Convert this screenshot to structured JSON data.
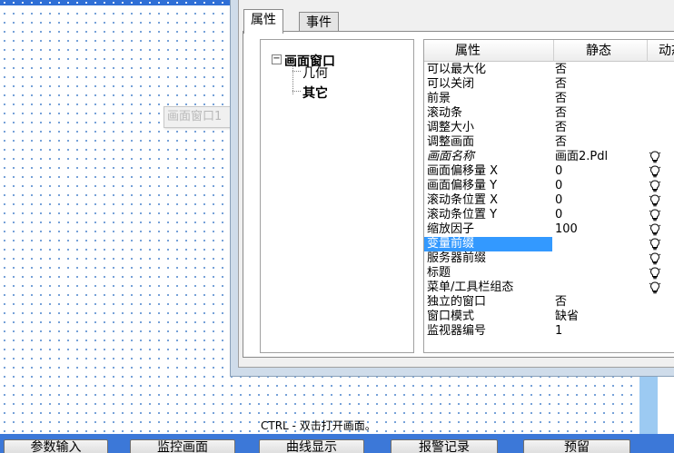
{
  "background_label": "画面窗口1",
  "hint_text": "CTRL - 双击打开画面。",
  "bottom_buttons": [
    "参数输入",
    "监控画面",
    "曲线显示",
    "报警记录",
    "预留"
  ],
  "dialog": {
    "tabs": [
      {
        "label": "属性",
        "active": true
      },
      {
        "label": "事件",
        "active": false
      }
    ],
    "tree": {
      "root": "画面窗口",
      "root_toggle": "−",
      "children": [
        "几何",
        "其它"
      ],
      "selected": "其它"
    },
    "grid": {
      "headers": [
        "属性",
        "静态",
        "动态"
      ],
      "rows": [
        {
          "name": "可以最大化",
          "static": "否",
          "dynamic": false,
          "italic": false,
          "selected": false
        },
        {
          "name": "可以关闭",
          "static": "否",
          "dynamic": false,
          "italic": false,
          "selected": false
        },
        {
          "name": "前景",
          "static": "否",
          "dynamic": false,
          "italic": false,
          "selected": false
        },
        {
          "name": "滚动条",
          "static": "否",
          "dynamic": false,
          "italic": false,
          "selected": false
        },
        {
          "name": "调整大小",
          "static": "否",
          "dynamic": false,
          "italic": false,
          "selected": false
        },
        {
          "name": "调整画面",
          "static": "否",
          "dynamic": false,
          "italic": false,
          "selected": false
        },
        {
          "name": "画面名称",
          "static": "画面2.Pdl",
          "dynamic": true,
          "italic": true,
          "selected": false
        },
        {
          "name": "画面偏移量 X",
          "static": "0",
          "dynamic": true,
          "italic": false,
          "selected": false
        },
        {
          "name": "画面偏移量 Y",
          "static": "0",
          "dynamic": true,
          "italic": false,
          "selected": false
        },
        {
          "name": "滚动条位置 X",
          "static": "0",
          "dynamic": true,
          "italic": false,
          "selected": false
        },
        {
          "name": "滚动条位置 Y",
          "static": "0",
          "dynamic": true,
          "italic": false,
          "selected": false
        },
        {
          "name": "缩放因子",
          "static": "100",
          "dynamic": true,
          "italic": false,
          "selected": false
        },
        {
          "name": "变量前缀",
          "static": "",
          "dynamic": true,
          "italic": false,
          "selected": true
        },
        {
          "name": "服务器前缀",
          "static": "",
          "dynamic": true,
          "italic": false,
          "selected": false
        },
        {
          "name": "标题",
          "static": "",
          "dynamic": true,
          "italic": false,
          "selected": false
        },
        {
          "name": "菜单/工具栏组态",
          "static": "",
          "dynamic": true,
          "italic": false,
          "selected": false
        },
        {
          "name": "独立的窗口",
          "static": "否",
          "dynamic": false,
          "italic": false,
          "selected": false
        },
        {
          "name": "窗口模式",
          "static": "缺省",
          "dynamic": false,
          "italic": false,
          "selected": false
        },
        {
          "name": "监视器编号",
          "static": "1",
          "dynamic": false,
          "italic": false,
          "selected": false
        }
      ]
    }
  },
  "colors": {
    "canvas_dots": "#5b8fd0",
    "selection": "#3399ff",
    "bottom_strip": "#3c78d8",
    "dialog_frame": "#cfdcea"
  },
  "icons": {
    "dynamic": "lightbulb-icon",
    "tree_toggle": "tree-collapse-icon"
  }
}
